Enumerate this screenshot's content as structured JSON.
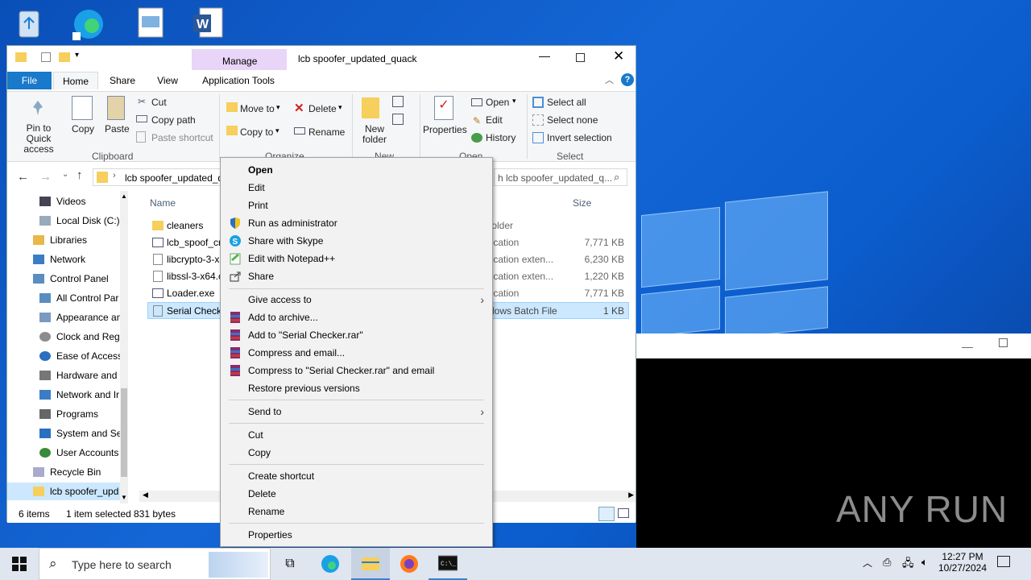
{
  "explorer": {
    "title": "lcb spoofer_updated_quack",
    "contextual_tab": "Manage",
    "tabs": [
      "File",
      "Home",
      "Share",
      "View",
      "Application Tools"
    ],
    "ribbon": {
      "pin_label": "Pin to Quick access",
      "copy_label": "Copy",
      "paste_label": "Paste",
      "cut_label": "Cut",
      "copy_path_label": "Copy path",
      "paste_shortcut_label": "Paste shortcut",
      "clipboard_group": "Clipboard",
      "move_to_label": "Move to",
      "copy_to_label": "Copy to",
      "delete_label": "Delete",
      "rename_label": "Rename",
      "organize_group": "Organize",
      "new_folder_label": "New folder",
      "new_group": "New",
      "properties_label": "Properties",
      "open_label": "Open",
      "edit_label": "Edit",
      "history_label": "History",
      "open_group": "Open",
      "select_all_label": "Select all",
      "select_none_label": "Select none",
      "invert_label": "Invert selection",
      "select_group": "Select"
    },
    "address_path": "lcb spoofer_updated_q",
    "search_placeholder": "h lcb spoofer_updated_q...",
    "nav_items": [
      {
        "label": "Videos"
      },
      {
        "label": "Local Disk (C:)"
      },
      {
        "label": "Libraries"
      },
      {
        "label": "Network"
      },
      {
        "label": "Control Panel"
      },
      {
        "label": "All Control Par"
      },
      {
        "label": "Appearance an"
      },
      {
        "label": "Clock and Regi"
      },
      {
        "label": "Ease of Access"
      },
      {
        "label": "Hardware and"
      },
      {
        "label": "Network and Ir"
      },
      {
        "label": "Programs"
      },
      {
        "label": "System and Sec"
      },
      {
        "label": "User Accounts"
      },
      {
        "label": "Recycle Bin"
      },
      {
        "label": "lcb spoofer_upd"
      }
    ],
    "columns": {
      "name": "Name",
      "size": "Size"
    },
    "files": [
      {
        "name": "cleaners",
        "type": "folder",
        "size": ""
      },
      {
        "name": "lcb_spoof_cr",
        "type": "lication",
        "size": "7,771 KB"
      },
      {
        "name": "libcrypto-3-x",
        "type": "lication exten...",
        "size": "6,230 KB"
      },
      {
        "name": "libssl-3-x64.c",
        "type": "lication exten...",
        "size": "1,220 KB"
      },
      {
        "name": "Loader.exe",
        "type": "lication",
        "size": "7,771 KB"
      },
      {
        "name": "Serial Checke",
        "type": "dows Batch File",
        "size": "1 KB"
      }
    ],
    "status": {
      "items": "6 items",
      "selected": "1 item selected",
      "bytes": "831 bytes"
    }
  },
  "context_menu": {
    "open": "Open",
    "edit": "Edit",
    "print": "Print",
    "run_admin": "Run as administrator",
    "skype": "Share with Skype",
    "notepad": "Edit with Notepad++",
    "share": "Share",
    "give_access": "Give access to",
    "add_archive": "Add to archive...",
    "add_rar": "Add to \"Serial Checker.rar\"",
    "compress_email": "Compress and email...",
    "compress_rar_email": "Compress to \"Serial Checker.rar\" and email",
    "restore": "Restore previous versions",
    "send_to": "Send to",
    "cut": "Cut",
    "copy": "Copy",
    "create_shortcut": "Create shortcut",
    "delete": "Delete",
    "rename": "Rename",
    "properties": "Properties"
  },
  "taskbar": {
    "search_placeholder": "Type here to search",
    "time": "12:27 PM",
    "date": "10/27/2024"
  },
  "watermark": "ANY RUN"
}
